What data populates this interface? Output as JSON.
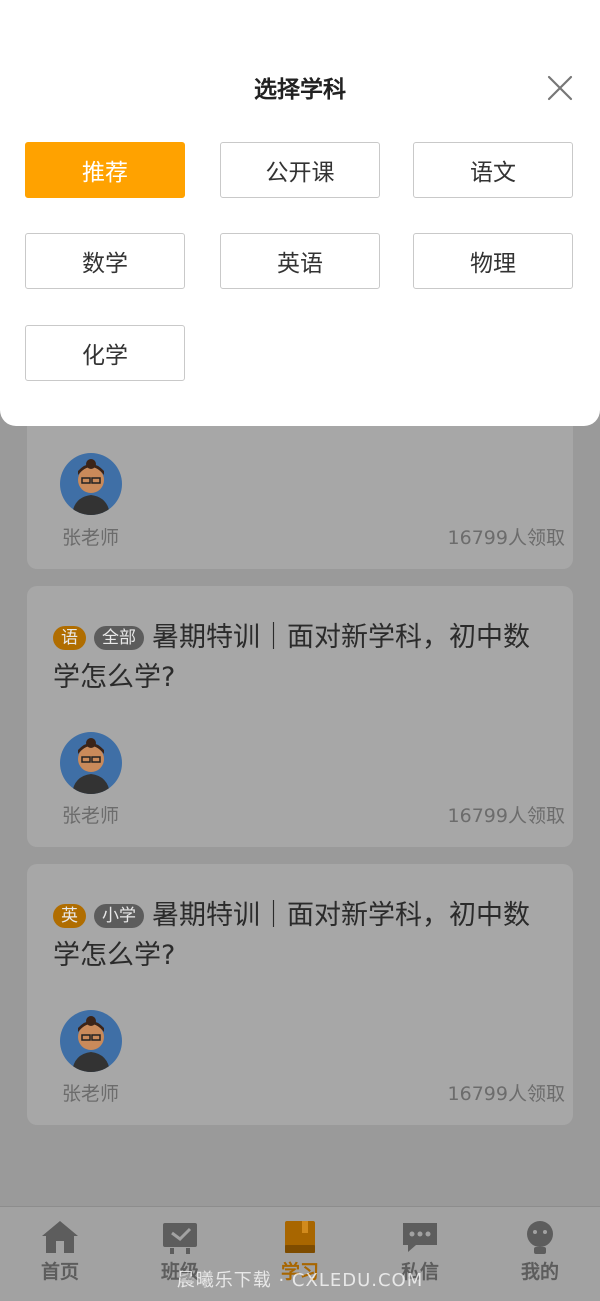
{
  "sheet": {
    "title": "选择学科",
    "subjects": [
      {
        "label": "推荐",
        "active": true
      },
      {
        "label": "公开课",
        "active": false
      },
      {
        "label": "语文",
        "active": false
      },
      {
        "label": "数学",
        "active": false
      },
      {
        "label": "英语",
        "active": false
      },
      {
        "label": "物理",
        "active": false
      },
      {
        "label": "化学",
        "active": false
      }
    ]
  },
  "courses": [
    {
      "teacher": "张老师",
      "claimed": "16799人领取"
    },
    {
      "subject_tag": "语",
      "level_tag": "全部",
      "title": "暑期特训｜面对新学科，初中数学怎么学?",
      "teacher": "张老师",
      "claimed": "16799人领取"
    },
    {
      "subject_tag": "英",
      "level_tag": "小学",
      "title": "暑期特训｜面对新学科，初中数学怎么学?",
      "teacher": "张老师",
      "claimed": "16799人领取"
    }
  ],
  "tabbar": {
    "items": [
      {
        "label": "首页",
        "icon": "home-icon"
      },
      {
        "label": "班级",
        "icon": "class-icon"
      },
      {
        "label": "学习",
        "icon": "book-icon",
        "active": true
      },
      {
        "label": "私信",
        "icon": "message-icon"
      },
      {
        "label": "我的",
        "icon": "profile-icon"
      }
    ]
  },
  "watermark": "晨曦乐下载 · CXLEDU.COM",
  "colors": {
    "accent": "#ffa200",
    "overlay": "#9a9a9a"
  }
}
